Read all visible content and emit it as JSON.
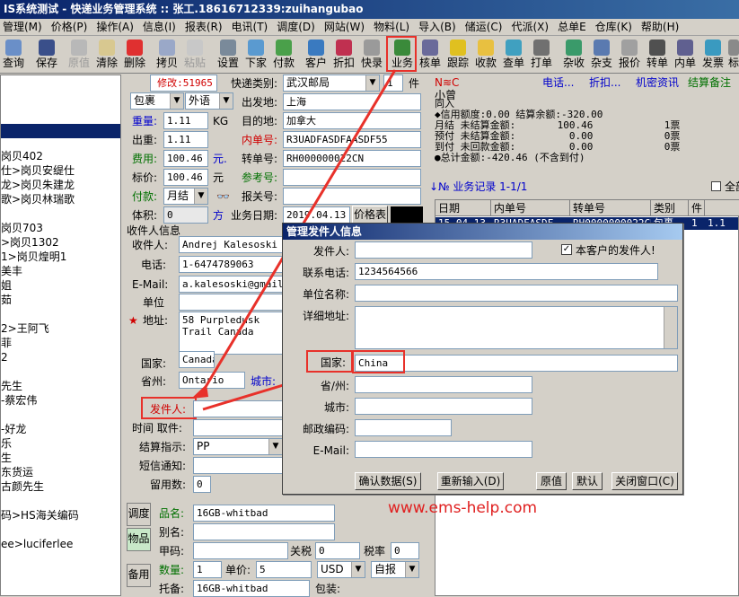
{
  "window": {
    "title": "IS系统测试  - 快递业务管理系统 :: 张工.18616712339:zuihangubao"
  },
  "menu": [
    "管理(M)",
    "价格(P)",
    "操作(A)",
    "信息(I)",
    "报表(R)",
    "电讯(T)",
    "调度(D)",
    "网站(W)",
    "物料(L)",
    "导入(B)",
    "储运(C)",
    "代派(X)",
    "总单E",
    "仓库(K)",
    "帮助(H)"
  ],
  "toolbar": {
    "query": "查询",
    "save": "保存",
    "origin": "原值",
    "clear": "清除",
    "delete": "删除",
    "copy": "拷贝",
    "paste": "粘贴",
    "settings": "设置",
    "next_order": "下家",
    "payment": "付款",
    "customer": "客户",
    "discount": "折扣",
    "quick_entry": "快录",
    "business": "业务",
    "check_order": "核单",
    "track": "跟踪",
    "receive": "收款",
    "check_order2": "查单",
    "print_order": "打单",
    "misc_fee": "杂收",
    "misc_pay": "杂支",
    "quote": "报价",
    "transfer": "转单",
    "inner_order": "内单",
    "invoice": "发票",
    "mark": "标"
  },
  "tree": {
    "items": [
      "岗贝402",
      "仕>岗贝安缇仕",
      "龙>岗贝朱建龙",
      "歌>岗贝林瑞歌",
      "岗贝703",
      ">岗贝1302",
      "1>岗贝煌明1",
      "美丰",
      "姐",
      "茹",
      "2>王阿飞",
      "菲",
      "2",
      "先生",
      "-蔡宏伟",
      "-好龙",
      "乐",
      "生",
      "东货运",
      "古颜先生",
      "码>HS海关编码",
      "ee>luciferlee"
    ]
  },
  "order": {
    "modify_id": "修改:51965",
    "package_type": "包裹",
    "lang": "外语",
    "weight_label": "重量:",
    "weight": "1.11",
    "weight_unit": "KG",
    "out_weight_label": "出重:",
    "out_weight": "1.11",
    "fee_label": "费用:",
    "fee": "100.46",
    "fee_unit": "元.",
    "price_label": "标价:",
    "price": "100.46",
    "price_unit": "元",
    "pay_label": "付款:",
    "pay": "月结",
    "volume_label": "体积:",
    "volume": "0",
    "volume_unit": "方",
    "express_type_label": "快递类别:",
    "express_type": "武汉邮局",
    "pieces": "1",
    "pieces_unit": "件",
    "origin_label": "出发地:",
    "origin": "上海",
    "destination_label": "目的地:",
    "destination": "加拿大",
    "inner_no_label": "内单号:",
    "inner_no": "R3UADFASDFAASDF55",
    "transfer_no_label": "转单号:",
    "transfer_no": "RH000000022CN",
    "ref_no_label": "参考号:",
    "ref_no": "",
    "report_no_label": "报关号:",
    "report_no": "",
    "biz_date_label": "业务日期:",
    "biz_date": "2019.04.13",
    "price_table": "价格表"
  },
  "receiver": {
    "section": "收件人信息",
    "name_label": "收件人:",
    "name": "Andrej Kalesoski",
    "phone_label": "电话:",
    "phone": "1-6474789063",
    "email_label": "E-Mail:",
    "email": "a.kalesoski@gmail.c",
    "company_label": "单位",
    "company": "",
    "address_label": "地址:",
    "address": "58 Purpledusk Trail Canada",
    "country_label": "国家:",
    "country": "Canada",
    "province_label": "省州:",
    "province": "Ontario",
    "city_label": "城市:"
  },
  "sender_section": {
    "sender_label": "发件人:",
    "pickup_label": "时间 取件:",
    "settle_label": "结算指示:",
    "settle": "PP",
    "sms_label": "短信通知:",
    "remain_label": "留用数:",
    "remain": "0"
  },
  "goods": {
    "tabs": [
      "调度",
      "物品",
      "备用"
    ],
    "name_label": "品名:",
    "name": "16GB-whitbad",
    "alias_label": "别名:",
    "code_label": "甲码:",
    "tariff_label": "关税",
    "tariff": "0",
    "tax_label": "税率",
    "tax": "0",
    "qty_label": "数量:",
    "qty": "1",
    "unit_price_label": "单价:",
    "unit_price": "5",
    "currency": "USD",
    "self_report": "自报",
    "entrust_label": "托备:",
    "entrust": "16GB-whitbad",
    "packing_label": "包装:"
  },
  "right": {
    "header_code": "N≋C",
    "links": [
      "电话...",
      "折扣...",
      "机密资讯",
      "结算备注"
    ],
    "customer_name": "小曾",
    "customer_lines": [
      "同入",
      "◆信用额度:0.00 结算余额:-320.00",
      "月结 未结算金额:       100.46            1票",
      "预付 未结算金额:         0.00            0票",
      "到付 未回款金额:         0.00            0票",
      "●总计金额:-420.46 (不含到付)"
    ],
    "records_label": "↓№ 业务记录 1-1/1",
    "all_label": "全部",
    "columns": [
      "日期",
      "内单号",
      "转单号",
      "类别",
      "件",
      ""
    ],
    "row": [
      "15.04.13",
      "R3UADFASDF",
      "RH0000000022CN",
      "包裹",
      "1",
      "1.1"
    ]
  },
  "dialog": {
    "title": "管理发件人信息",
    "sender_label": "发件人:",
    "sender": "",
    "is_customer_sender": "本客户的发件人!",
    "phone_label": "联系电话:",
    "phone": "1234564566",
    "company_label": "单位名称:",
    "company": "",
    "address_label": "详细地址:",
    "address": "",
    "country_label": "国家:",
    "country": "China",
    "province_label": "省/州:",
    "province": "",
    "city_label": "城市:",
    "city": "",
    "zip_label": "邮政编码:",
    "zip": "",
    "email_label": "E-Mail:",
    "email": "",
    "confirm": "确认数据(S)",
    "reenter": "重新输入(D)",
    "origin": "原值",
    "default": "默认",
    "close": "关闭窗口(C)"
  },
  "watermark": "www.ems-help.com",
  "colors": {
    "annotation_red": "#e8312a",
    "title_blue": "#0a246a",
    "link_blue": "#0000cc"
  }
}
